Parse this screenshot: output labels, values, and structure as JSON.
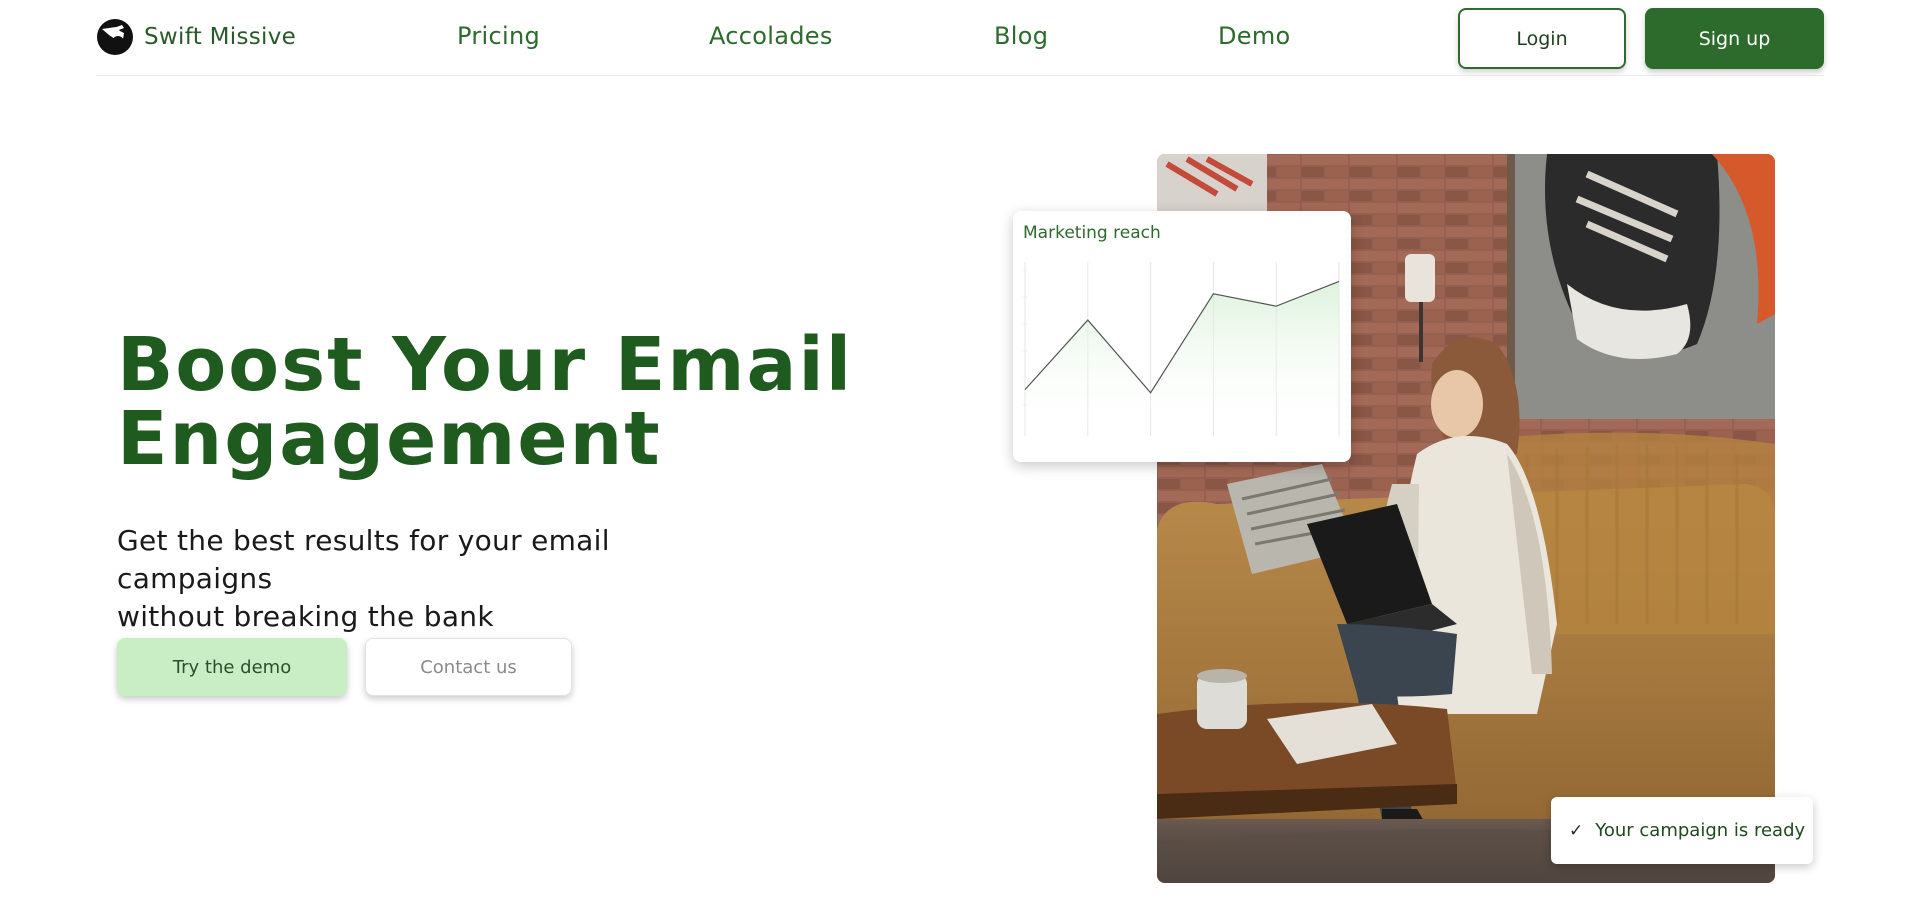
{
  "brand": {
    "name": "Swift Missive",
    "logo_icon": "pointing-hand-logo"
  },
  "nav": {
    "links": [
      "Pricing",
      "Accolades",
      "Blog",
      "Demo"
    ],
    "login_label": "Login",
    "signup_label": "Sign up"
  },
  "hero": {
    "title_line1": "Boost Your Email",
    "title_line2": "Engagement",
    "subtitle_line1": "Get the best results for your email campaigns",
    "subtitle_line2": "without breaking the bank",
    "primary_cta": "Try the demo",
    "secondary_cta": "Contact us",
    "image_subject": "woman-on-sofa-with-laptop"
  },
  "toast": {
    "icon": "check-icon",
    "text": "Your campaign is ready"
  },
  "colors": {
    "brand_green": "#2c6b2c",
    "title_green": "#1f5a1f",
    "light_green": "#c9eec5"
  },
  "chart_data": {
    "type": "line",
    "title": "Marketing reach",
    "categories": [
      "",
      "",
      "",
      "",
      "",
      ""
    ],
    "values": [
      0.3,
      0.75,
      0.28,
      0.92,
      0.84,
      1.0
    ],
    "ylim": [
      0,
      1.1
    ],
    "grid": true
  }
}
